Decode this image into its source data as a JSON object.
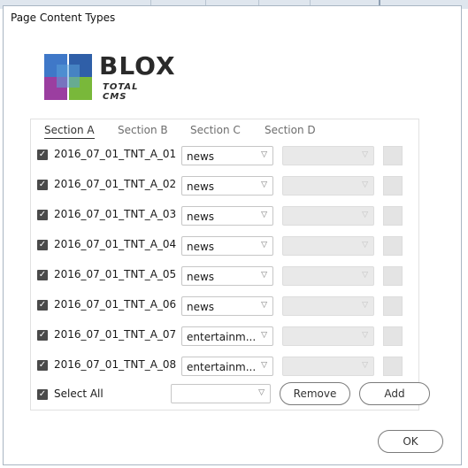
{
  "dialog": {
    "title": "Page Content Types",
    "logo": {
      "word": "BLOX",
      "sub": "TOTAL CMS"
    },
    "tabs": [
      {
        "label": "Section A",
        "active": true
      },
      {
        "label": "Section B",
        "active": false
      },
      {
        "label": "Section C",
        "active": false
      },
      {
        "label": "Section D",
        "active": false
      }
    ],
    "rows": [
      {
        "label": "2016_07_01_TNT_A_01",
        "checked": true,
        "type": "news"
      },
      {
        "label": "2016_07_01_TNT_A_02",
        "checked": true,
        "type": "news"
      },
      {
        "label": "2016_07_01_TNT_A_03",
        "checked": true,
        "type": "news"
      },
      {
        "label": "2016_07_01_TNT_A_04",
        "checked": true,
        "type": "news"
      },
      {
        "label": "2016_07_01_TNT_A_05",
        "checked": true,
        "type": "news"
      },
      {
        "label": "2016_07_01_TNT_A_06",
        "checked": true,
        "type": "news"
      },
      {
        "label": "2016_07_01_TNT_A_07",
        "checked": true,
        "type": "entertainm..."
      },
      {
        "label": "2016_07_01_TNT_A_08",
        "checked": true,
        "type": "entertainm..."
      }
    ],
    "select_all": {
      "label": "Select All",
      "checked": true,
      "value": ""
    },
    "remove_label": "Remove",
    "add_label": "Add",
    "ok_label": "OK"
  },
  "icons": {
    "checkbox": "checkmark-icon",
    "dropdown": "chevron-down-icon"
  }
}
